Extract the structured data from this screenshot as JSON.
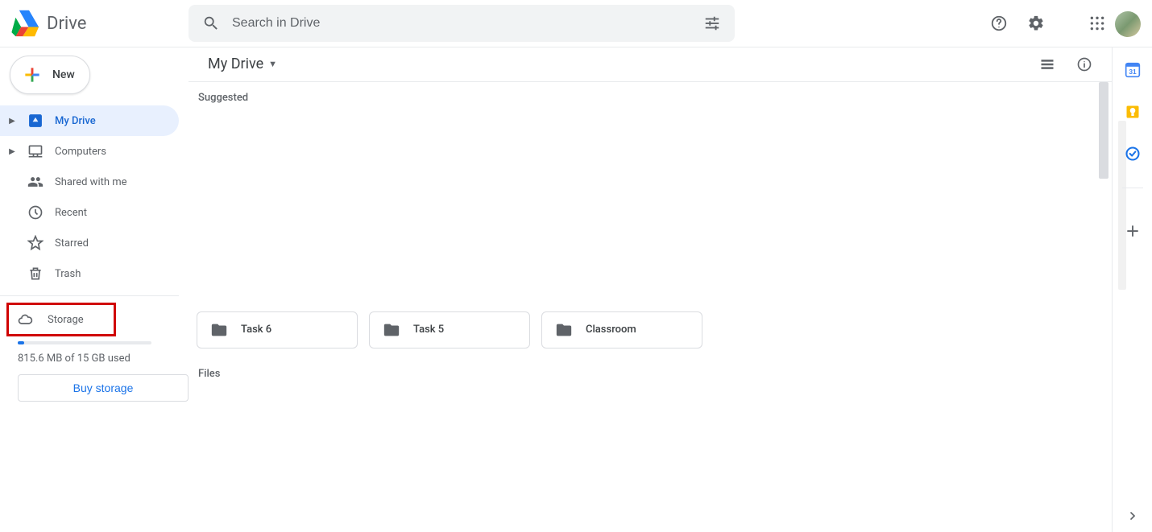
{
  "app": {
    "name": "Drive"
  },
  "search": {
    "placeholder": "Search in Drive"
  },
  "sidebar": {
    "new_label": "New",
    "items": [
      {
        "label": "My Drive"
      },
      {
        "label": "Computers"
      },
      {
        "label": "Shared with me"
      },
      {
        "label": "Recent"
      },
      {
        "label": "Starred"
      },
      {
        "label": "Trash"
      }
    ],
    "storage": {
      "label": "Storage",
      "usage_text": "815.6 MB of 15 GB used",
      "buy_label": "Buy storage",
      "percent_used": 5
    }
  },
  "toolbar": {
    "path": "My Drive"
  },
  "content": {
    "suggested_heading": "Suggested",
    "files_heading": "Files",
    "folders": [
      {
        "name": "Task 6"
      },
      {
        "name": "Task 5"
      },
      {
        "name": "Classroom"
      }
    ]
  },
  "side_apps": {
    "calendar_color": "#4285f4",
    "keep_color": "#fbbc04",
    "tasks_color": "#1a73e8"
  }
}
